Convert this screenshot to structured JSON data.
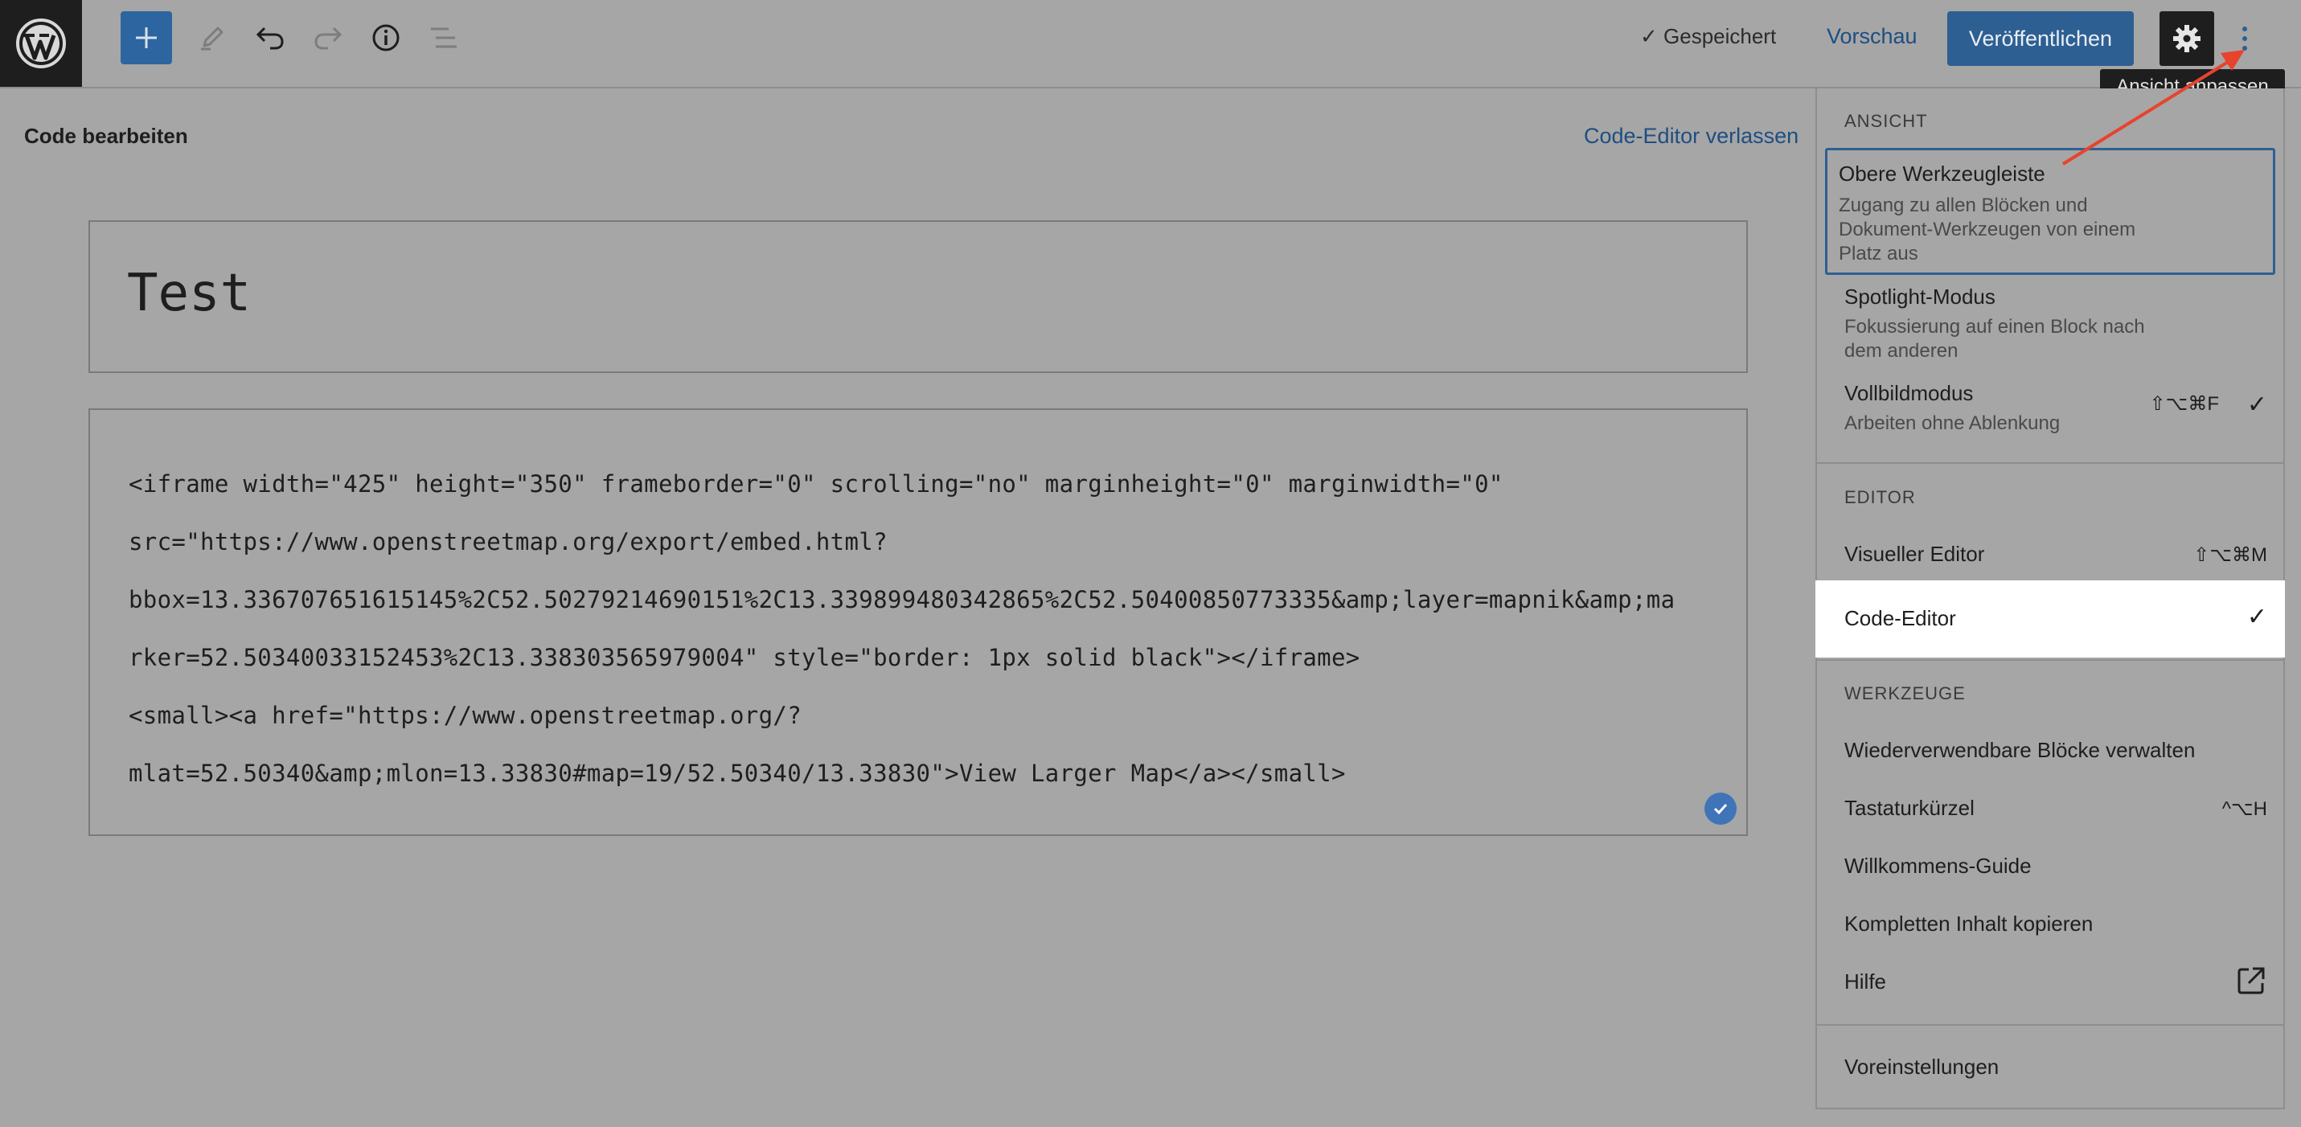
{
  "topbar": {
    "saved_label": "✓ Gespeichert",
    "preview_label": "Vorschau",
    "publish_label": "Veröffentlichen",
    "tooltip": "Ansicht anpassen"
  },
  "editor": {
    "heading": "Code bearbeiten",
    "exit_label": "Code-Editor verlassen",
    "title": "Test",
    "code_lines": [
      "<iframe width=\"425\" height=\"350\" frameborder=\"0\" scrolling=\"no\" marginheight=\"0\" marginwidth=\"0\"",
      "src=\"https://www.openstreetmap.org/export/embed.html?",
      "bbox=13.336707651615145%2C52.50279214690151%2C13.339899480342865%2C52.50400850773335&amp;layer=mapnik&amp;ma",
      "rker=52.50340033152453%2C13.338303565979004\" style=\"border: 1px solid black\"></iframe>",
      "<small><a href=\"https://www.openstreetmap.org/?",
      "mlat=52.50340&amp;mlon=13.33830#map=19/52.50340/13.33830\">View Larger Map</a></small>"
    ]
  },
  "menu": {
    "ansicht": {
      "label": "ANSICHT",
      "items": [
        {
          "label": "Obere Werkzeugleiste",
          "desc": "Zugang zu allen Blöcken und Dokument-Werkzeugen von einem Platz aus",
          "shortcut": "",
          "checked": false
        },
        {
          "label": "Spotlight-Modus",
          "desc": "Fokussierung auf einen Block nach dem anderen",
          "shortcut": "",
          "checked": false
        },
        {
          "label": "Vollbildmodus",
          "desc": "Arbeiten ohne Ablenkung",
          "shortcut": "⇧⌥⌘F",
          "checked": true
        }
      ]
    },
    "editor": {
      "label": "EDITOR",
      "items": [
        {
          "label": "Visueller Editor",
          "shortcut": "⇧⌥⌘M",
          "checked": false
        },
        {
          "label": "Code-Editor",
          "shortcut": "",
          "checked": true
        }
      ]
    },
    "werkzeuge": {
      "label": "WERKZEUGE",
      "items": [
        {
          "label": "Wiederverwendbare Blöcke verwalten",
          "shortcut": ""
        },
        {
          "label": "Tastaturkürzel",
          "shortcut": "^⌥H"
        },
        {
          "label": "Willkommens-Guide",
          "shortcut": ""
        },
        {
          "label": "Kompletten Inhalt kopieren",
          "shortcut": ""
        },
        {
          "label": "Hilfe",
          "shortcut": "",
          "icon": "external-link-icon"
        }
      ]
    },
    "settings_label": "Voreinstellungen",
    "check_mark": "✓"
  },
  "colors": {
    "accent": "#2d5f93",
    "overlay_bg": "#a6a6a6",
    "annotation": "#e8432c"
  }
}
